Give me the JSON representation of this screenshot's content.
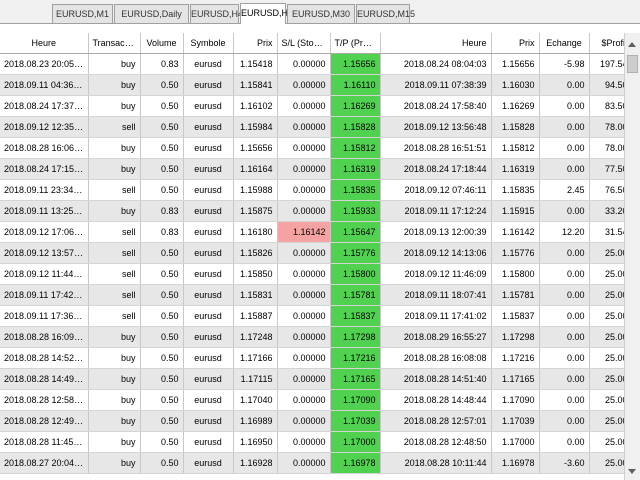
{
  "tabs": [
    "EURUSD,M1",
    "EURUSD,Daily",
    "EURUSD,H4",
    "EURUSD,H1",
    "EURUSD,M30",
    "EURUSD,M15"
  ],
  "active_tab": 3,
  "colors": {
    "green_cell": "#50d250",
    "red_cell": "#f4a2a2",
    "row_alt": "#e7e7e7"
  },
  "columns": [
    "Heure",
    "Transaction",
    "Volume",
    "Symbole",
    "Prix",
    "S/L (Stop/Per...",
    "T/P (Prendre...",
    "Heure",
    "Prix",
    "Echange",
    "$Profit"
  ],
  "rows": [
    [
      "2018.08.23 20:05:02",
      "buy",
      "0.83",
      "eurusd",
      "1.15418",
      "0.00000",
      "1.15656",
      "2018.08.24 08:04:03",
      "1.15656",
      "-5.98",
      "197.54"
    ],
    [
      "2018.09.11 04:36:35",
      "buy",
      "0.50",
      "eurusd",
      "1.15841",
      "0.00000",
      "1.16110",
      "2018.09.11 07:38:39",
      "1.16030",
      "0.00",
      "94.50"
    ],
    [
      "2018.08.24 17:37:01",
      "buy",
      "0.50",
      "eurusd",
      "1.16102",
      "0.00000",
      "1.16269",
      "2018.08.24 17:58:40",
      "1.16269",
      "0.00",
      "83.50"
    ],
    [
      "2018.09.12 12:35:01",
      "sell",
      "0.50",
      "eurusd",
      "1.15984",
      "0.00000",
      "1.15828",
      "2018.09.12 13:56:48",
      "1.15828",
      "0.00",
      "78.00"
    ],
    [
      "2018.08.28 16:06:00",
      "buy",
      "0.50",
      "eurusd",
      "1.15656",
      "0.00000",
      "1.15812",
      "2018.08.28 16:51:51",
      "1.15812",
      "0.00",
      "78.00"
    ],
    [
      "2018.08.24 17:15:01",
      "buy",
      "0.50",
      "eurusd",
      "1.16164",
      "0.00000",
      "1.16319",
      "2018.08.24 17:18:44",
      "1.16319",
      "0.00",
      "77.50"
    ],
    [
      "2018.09.11 23:34:02",
      "sell",
      "0.50",
      "eurusd",
      "1.15988",
      "0.00000",
      "1.15835",
      "2018.09.12 07:46:11",
      "1.15835",
      "2.45",
      "76.50"
    ],
    [
      "2018.09.11 13:25:01",
      "buy",
      "0.83",
      "eurusd",
      "1.15875",
      "0.00000",
      "1.15933",
      "2018.09.11 17:12:24",
      "1.15915",
      "0.00",
      "33.20"
    ],
    [
      "2018.09.12 17:06:00",
      "sell",
      "0.83",
      "eurusd",
      "1.16180",
      "1.16142",
      "1.15647",
      "2018.09.13 12:00:39",
      "1.16142",
      "12.20",
      "31.54"
    ],
    [
      "2018.09.12 13:57:01",
      "sell",
      "0.50",
      "eurusd",
      "1.15826",
      "0.00000",
      "1.15776",
      "2018.09.12 14:13:06",
      "1.15776",
      "0.00",
      "25.00"
    ],
    [
      "2018.09.12 11:44:01",
      "sell",
      "0.50",
      "eurusd",
      "1.15850",
      "0.00000",
      "1.15800",
      "2018.09.12 11:46:09",
      "1.15800",
      "0.00",
      "25.00"
    ],
    [
      "2018.09.11 17:42:00",
      "sell",
      "0.50",
      "eurusd",
      "1.15831",
      "0.00000",
      "1.15781",
      "2018.09.11 18:07:41",
      "1.15781",
      "0.00",
      "25.00"
    ],
    [
      "2018.09.11 17:36:01",
      "sell",
      "0.50",
      "eurusd",
      "1.15887",
      "0.00000",
      "1.15837",
      "2018.09.11 17:41:02",
      "1.15837",
      "0.00",
      "25.00"
    ],
    [
      "2018.08.28 16:09:00",
      "buy",
      "0.50",
      "eurusd",
      "1.17248",
      "0.00000",
      "1.17298",
      "2018.08.29 16:55:27",
      "1.17298",
      "0.00",
      "25.00"
    ],
    [
      "2018.08.28 14:52:00",
      "buy",
      "0.50",
      "eurusd",
      "1.17166",
      "0.00000",
      "1.17216",
      "2018.08.28 16:08:08",
      "1.17216",
      "0.00",
      "25.00"
    ],
    [
      "2018.08.28 14:49:00",
      "buy",
      "0.50",
      "eurusd",
      "1.17115",
      "0.00000",
      "1.17165",
      "2018.08.28 14:51:40",
      "1.17165",
      "0.00",
      "25.00"
    ],
    [
      "2018.08.28 12:58:02",
      "buy",
      "0.50",
      "eurusd",
      "1.17040",
      "0.00000",
      "1.17090",
      "2018.08.28 14:48:44",
      "1.17090",
      "0.00",
      "25.00"
    ],
    [
      "2018.08.28 12:49:00",
      "buy",
      "0.50",
      "eurusd",
      "1.16989",
      "0.00000",
      "1.17039",
      "2018.08.28 12:57:01",
      "1.17039",
      "0.00",
      "25.00"
    ],
    [
      "2018.08.28 11:45:37",
      "buy",
      "0.50",
      "eurusd",
      "1.16950",
      "0.00000",
      "1.17000",
      "2018.08.28 12:48:50",
      "1.17000",
      "0.00",
      "25.00"
    ],
    [
      "2018.08.27 20:04:03",
      "buy",
      "0.50",
      "eurusd",
      "1.16928",
      "0.00000",
      "1.16978",
      "2018.08.28 10:11:44",
      "1.16978",
      "-3.60",
      "25.00"
    ]
  ],
  "highlighted_sl_rows": [
    8
  ]
}
